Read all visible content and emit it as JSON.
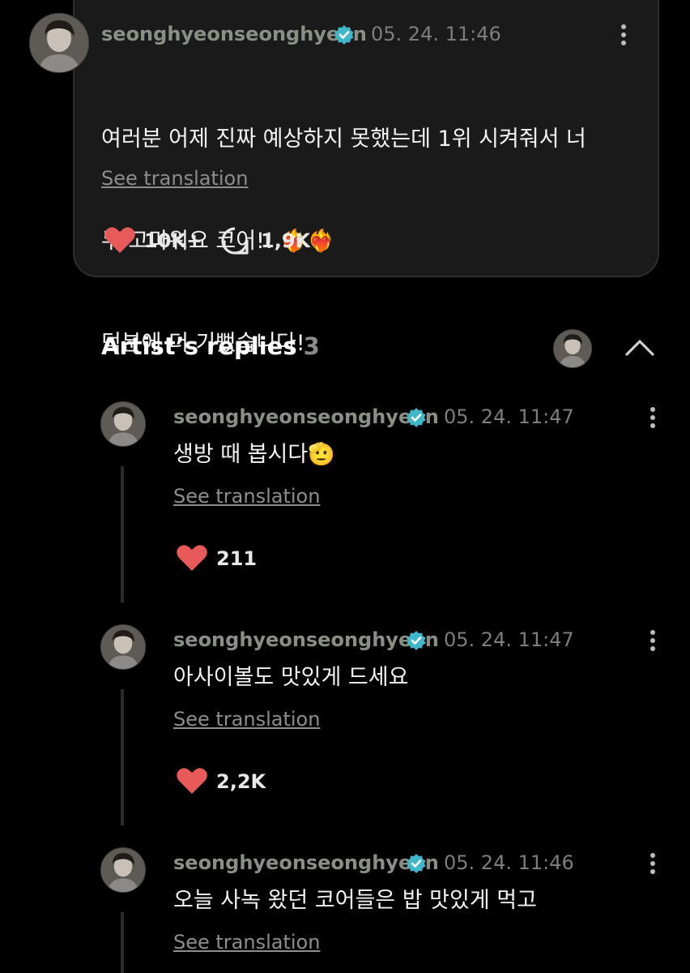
{
  "post": {
    "username": "seonghyeonseonghyeon",
    "timestamp": "05. 24. 11:46",
    "text_line1": "여러분 어제 진짜 예상하지 못했는데 1위 시켜줘서 너",
    "text_line2": "무 고마워요 코어!! ❤️‍🔥❤️‍🔥",
    "text_line3": "덕분에 더 기뻤습니다!",
    "see_translation": "See translation",
    "likes": "10K+",
    "comments": "1,9K"
  },
  "replies_header": {
    "title": "Artist’s replies",
    "count": "3"
  },
  "replies": [
    {
      "username": "seonghyeonseonghyeon",
      "timestamp": "05. 24. 11:47",
      "text": "생방 때 봅시다🫡",
      "see_translation": "See translation",
      "likes": "211"
    },
    {
      "username": "seonghyeonseonghyeon",
      "timestamp": "05. 24. 11:47",
      "text": "아사이볼도 맛있게 드세요",
      "see_translation": "See translation",
      "likes": "2,2K"
    },
    {
      "username": "seonghyeonseonghyeon",
      "timestamp": "05. 24. 11:46",
      "text": "오늘 사녹 왔던 코어들은 밥 맛있게 먹고",
      "see_translation": "See translation"
    }
  ],
  "colors": {
    "like_red": "#e85a5a",
    "verified_teal": "#3fb6c9",
    "card_bg": "#1a1a1a"
  },
  "icons": {
    "like": "heart-icon",
    "comment": "comment-bubble-icon",
    "verified": "verified-badge-icon",
    "menu": "more-vertical-icon",
    "collapse": "chevron-up-icon"
  }
}
